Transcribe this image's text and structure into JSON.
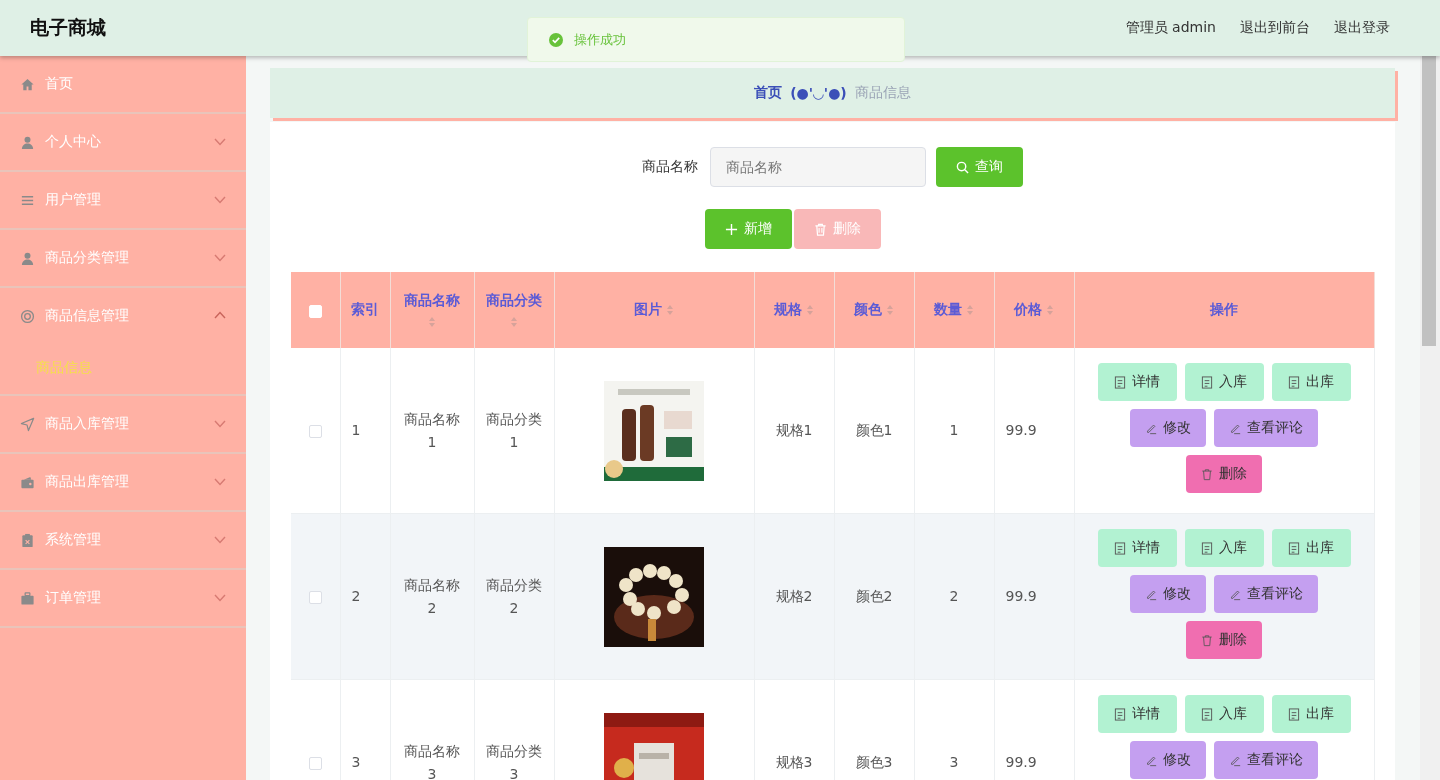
{
  "header": {
    "title": "电子商城",
    "user": "管理员 admin",
    "links": [
      "退出到前台",
      "退出登录"
    ]
  },
  "toast": {
    "message": "操作成功"
  },
  "sidebar": {
    "items": [
      {
        "label": "首页",
        "kind": "link"
      },
      {
        "label": "个人中心",
        "kind": "menu",
        "expanded": false
      },
      {
        "label": "用户管理",
        "kind": "menu",
        "expanded": false
      },
      {
        "label": "商品分类管理",
        "kind": "menu",
        "expanded": false
      },
      {
        "label": "商品信息管理",
        "kind": "menu",
        "expanded": true,
        "children": [
          {
            "label": "商品信息",
            "selected": true
          }
        ]
      },
      {
        "label": "商品入库管理",
        "kind": "menu",
        "expanded": false
      },
      {
        "label": "商品出库管理",
        "kind": "menu",
        "expanded": false
      },
      {
        "label": "系统管理",
        "kind": "menu",
        "expanded": false
      },
      {
        "label": "订单管理",
        "kind": "menu",
        "expanded": false
      }
    ]
  },
  "breadcrumb": {
    "home": "首页",
    "separator": "(●'◡'●)",
    "current": "商品信息"
  },
  "search": {
    "label": "商品名称",
    "placeholder": "商品名称",
    "button": "查询"
  },
  "toolbar": [
    {
      "label": "新增",
      "kind": "add"
    },
    {
      "label": "删除",
      "kind": "delete"
    }
  ],
  "table": {
    "select_all": {
      "checked": false
    },
    "columns": [
      {
        "label": "索引",
        "sortable": false
      },
      {
        "label": "商品名称",
        "sortable": true
      },
      {
        "label": "商品分类",
        "sortable": true
      },
      {
        "label": "图片",
        "sortable": true
      },
      {
        "label": "规格",
        "sortable": true
      },
      {
        "label": "颜色",
        "sortable": true
      },
      {
        "label": "数量",
        "sortable": true
      },
      {
        "label": "价格",
        "sortable": true
      },
      {
        "label": "操作",
        "sortable": false
      }
    ],
    "rows": [
      {
        "checked": false,
        "index": "1",
        "name": "商品名称1",
        "category": "商品分类1",
        "picture": {
          "kind": "picture"
        },
        "spec": "规格1",
        "color_label": "颜色1",
        "quantity": "1",
        "price": "99.9",
        "actions": [
          {
            "label": "详情",
            "kind": "info"
          },
          {
            "label": "入库",
            "kind": "info"
          },
          {
            "label": "出库",
            "kind": "info"
          },
          {
            "label": "修改",
            "kind": "edit"
          },
          {
            "label": "查看评论",
            "kind": "edit"
          },
          {
            "label": "删除",
            "kind": "delete"
          }
        ]
      },
      {
        "checked": false,
        "index": "2",
        "name": "商品名称2",
        "category": "商品分类2",
        "picture": {
          "kind": "picture"
        },
        "spec": "规格2",
        "color_label": "颜色2",
        "quantity": "2",
        "price": "99.9",
        "actions": [
          {
            "label": "详情",
            "kind": "info"
          },
          {
            "label": "入库",
            "kind": "info"
          },
          {
            "label": "出库",
            "kind": "info"
          },
          {
            "label": "修改",
            "kind": "edit"
          },
          {
            "label": "查看评论",
            "kind": "edit"
          },
          {
            "label": "删除",
            "kind": "delete"
          }
        ]
      },
      {
        "checked": false,
        "index": "3",
        "name": "商品名称3",
        "category": "商品分类3",
        "picture": {
          "kind": "picture"
        },
        "spec": "规格3",
        "color_label": "颜色3",
        "quantity": "3",
        "price": "99.9",
        "actions": [
          {
            "label": "详情",
            "kind": "info"
          },
          {
            "label": "入库",
            "kind": "info"
          },
          {
            "label": "出库",
            "kind": "info"
          },
          {
            "label": "修改",
            "kind": "edit"
          },
          {
            "label": "查看评论",
            "kind": "edit"
          }
        ]
      }
    ]
  }
}
